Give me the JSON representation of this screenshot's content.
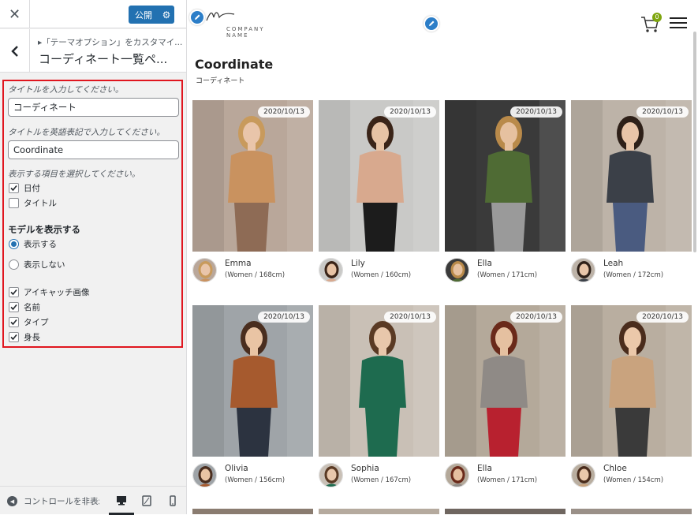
{
  "panel": {
    "close_icon": "close-icon",
    "publish_label": "公開",
    "breadcrumb": "▸「テーマオプション」をカスタマイ...",
    "section_title": "コーディネート一覧ペ...",
    "controls": {
      "title_label": "タイトルを入力してください。",
      "title_value": "コーディネート",
      "title_en_label": "タイトルを英語表記で入力してください。",
      "title_en_value": "Coordinate",
      "items_label": "表示する項目を選択してください。",
      "items": [
        {
          "label": "日付",
          "checked": true
        },
        {
          "label": "タイトル",
          "checked": false
        }
      ],
      "model_heading": "モデルを表示する",
      "model_options": [
        {
          "label": "表示する",
          "selected": true
        },
        {
          "label": "表示しない",
          "selected": false
        }
      ],
      "model_fields": [
        {
          "label": "アイキャッチ画像",
          "checked": true
        },
        {
          "label": "名前",
          "checked": true
        },
        {
          "label": "タイプ",
          "checked": true
        },
        {
          "label": "身長",
          "checked": true
        }
      ]
    },
    "footer": {
      "hide_controls_label": "コントロールを非表示",
      "devices": [
        "desktop",
        "tablet",
        "mobile"
      ],
      "active_device": "desktop"
    }
  },
  "preview": {
    "logo_text": "COMPANY NAME",
    "cart_count": "0",
    "page_title": "Coordinate",
    "page_subtitle": "コーディネート",
    "cards": [
      {
        "date": "2020/10/13",
        "name": "Emma",
        "info": "(Women / 168cm)",
        "colors": {
          "bg": "#b9a79a",
          "top": "#c9925f",
          "bottom": "#8e6b55",
          "skin": "#e9c5aa",
          "hair": "#c89a5c"
        }
      },
      {
        "date": "2020/10/13",
        "name": "Lily",
        "info": "(Women / 160cm)",
        "colors": {
          "bg": "#c9c9c7",
          "top": "#d8a98e",
          "bottom": "#1c1c1c",
          "skin": "#e7c3a5",
          "hair": "#3a2418"
        }
      },
      {
        "date": "2020/10/13",
        "name": "Ella",
        "info": "(Women / 171cm)",
        "colors": {
          "bg": "#3a3a3a",
          "top": "#4f6b34",
          "bottom": "#9a9a9a",
          "skin": "#e6c1a0",
          "hair": "#b98a4a"
        }
      },
      {
        "date": "2020/10/13",
        "name": "Leah",
        "info": "(Women / 172cm)",
        "colors": {
          "bg": "#bdb3a8",
          "top": "#3b4048",
          "bottom": "#4a5b80",
          "skin": "#e8c5a8",
          "hair": "#2e2018"
        }
      },
      {
        "date": "2020/10/13",
        "name": "Olivia",
        "info": "(Women / 156cm)",
        "colors": {
          "bg": "#9fa4a8",
          "top": "#a65a2e",
          "bottom": "#2c3340",
          "skin": "#e9c4a4",
          "hair": "#4a2e1f"
        }
      },
      {
        "date": "2020/10/13",
        "name": "Sophia",
        "info": "(Women / 167cm)",
        "colors": {
          "bg": "#c9c0b6",
          "top": "#1e6b4f",
          "bottom": "#1e6b4f",
          "skin": "#e8c7ab",
          "hair": "#5a3a24"
        }
      },
      {
        "date": "2020/10/13",
        "name": "Ella",
        "info": "(Women / 171cm)",
        "colors": {
          "bg": "#b4a99a",
          "top": "#8f8a86",
          "bottom": "#b8212f",
          "skin": "#e5c0a0",
          "hair": "#6a2a1a"
        }
      },
      {
        "date": "2020/10/13",
        "name": "Chloe",
        "info": "(Women / 154cm)",
        "colors": {
          "bg": "#b9aea0",
          "top": "#c9a37e",
          "bottom": "#3a3a3a",
          "skin": "#ebc8aa",
          "hair": "#4a2c1c"
        }
      }
    ]
  }
}
